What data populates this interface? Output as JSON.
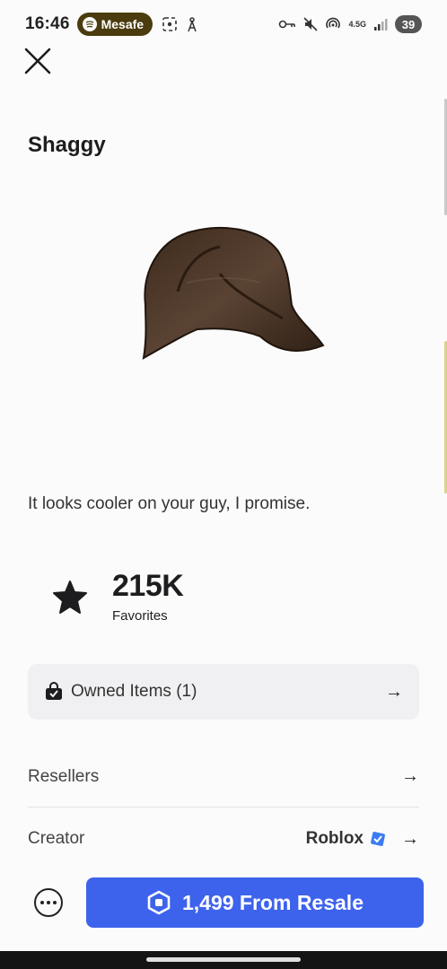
{
  "status_bar": {
    "time": "16:46",
    "spotify_label": "Mesafe",
    "network_label": "4.5G",
    "battery": "39"
  },
  "item": {
    "title": "Shaggy",
    "description": "It looks cooler on your guy, I promise.",
    "favorites_count": "215K",
    "favorites_label": "Favorites"
  },
  "owned": {
    "label": "Owned Items (1)",
    "arrow": "→"
  },
  "resellers": {
    "label": "Resellers",
    "arrow": "→"
  },
  "creator": {
    "label": "Creator",
    "name": "Roblox",
    "arrow": "→"
  },
  "purchase": {
    "label": "1,499 From Resale"
  },
  "colors": {
    "accent": "#3d63ec",
    "spotify_pill": "#4a3c0e",
    "verified": "#3d7bf2"
  },
  "icons": {
    "close": "close-icon",
    "favorite": "star-icon",
    "owned": "shopping-bag-icon",
    "verified": "verified-badge-icon",
    "more": "more-options-icon",
    "currency": "robux-icon"
  }
}
